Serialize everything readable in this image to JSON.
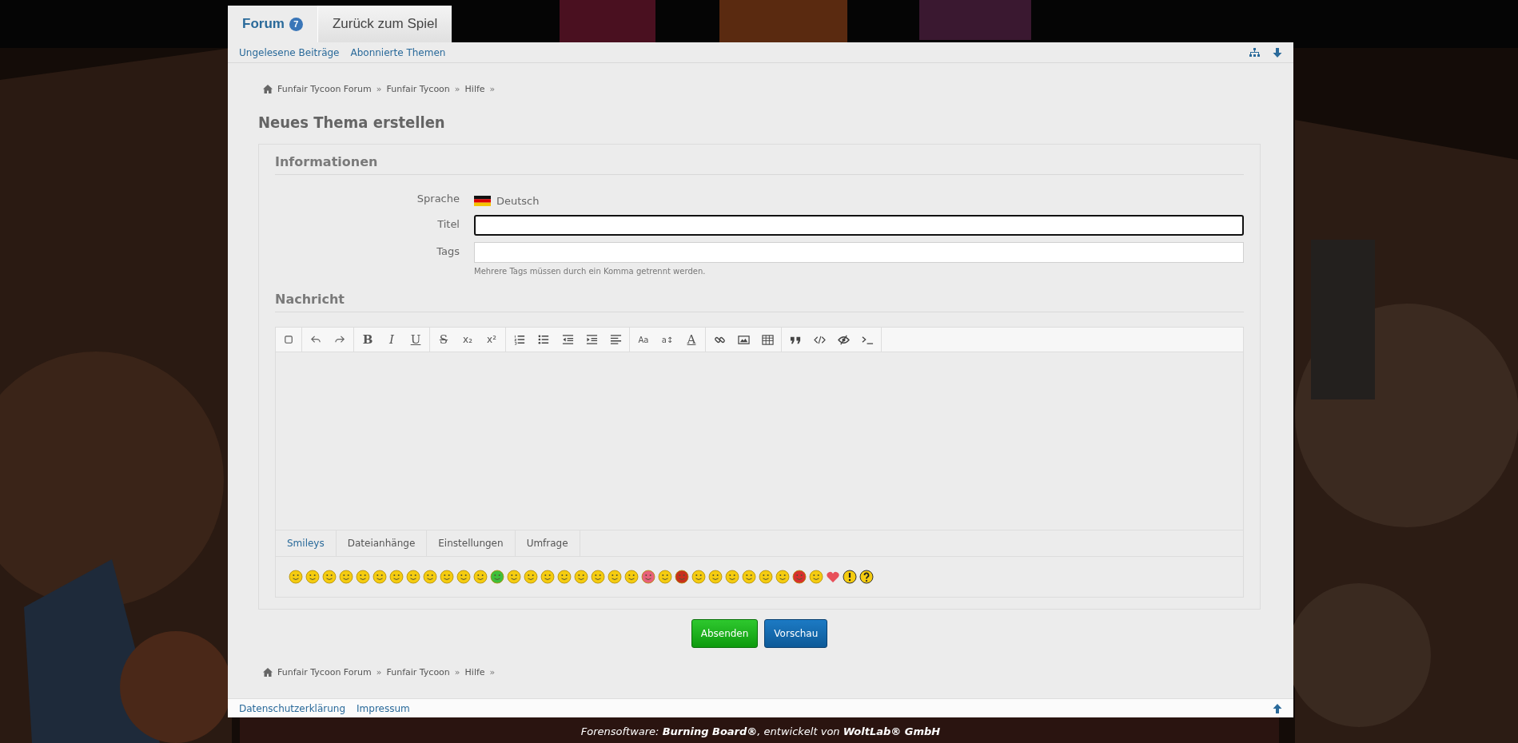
{
  "main_tabs": [
    {
      "label": "Forum",
      "badge": "7",
      "selected": true
    },
    {
      "label": "Zurück zum Spiel",
      "selected": false
    }
  ],
  "subnav": [
    "Ungelesene Beiträge",
    "Abonnierte Themen"
  ],
  "breadcrumb_top": [
    "Funfair Tycoon Forum",
    "»",
    "Funfair Tycoon",
    "»",
    "Hilfe",
    "»"
  ],
  "page_title": "Neues Thema erstellen",
  "sections": [
    {
      "heading": "Informationen"
    },
    {
      "heading": "Nachricht"
    }
  ],
  "fields": [
    {
      "kind": "language",
      "label": "Sprache",
      "value": "Deutsch"
    },
    {
      "kind": "input",
      "label": "Titel",
      "focused": true
    },
    {
      "kind": "input",
      "label": "Tags",
      "focused": false,
      "hint": "Mehrere Tags müssen durch ein Komma getrennt werden."
    }
  ],
  "toolbar": [
    [
      {
        "kind": "icon"
      }
    ],
    [
      {
        "kind": "icon"
      },
      {
        "kind": "icon"
      }
    ],
    [
      {
        "kind": "glyph",
        "text": "B"
      },
      {
        "kind": "glyph",
        "text": "I"
      },
      {
        "kind": "glyph",
        "text": "U"
      }
    ],
    [
      {
        "kind": "glyph",
        "text": "S"
      },
      {
        "kind": "glyph",
        "text": "x₂"
      },
      {
        "kind": "glyph",
        "text": "x²"
      }
    ],
    [
      {
        "kind": "icon"
      },
      {
        "kind": "icon"
      },
      {
        "kind": "icon"
      },
      {
        "kind": "icon"
      },
      {
        "kind": "icon"
      }
    ],
    [
      {
        "kind": "glyph",
        "text": "Aa"
      },
      {
        "kind": "glyph",
        "text": "a↕"
      },
      {
        "kind": "glyph",
        "text": "A"
      }
    ],
    [
      {
        "kind": "icon"
      },
      {
        "kind": "icon"
      },
      {
        "kind": "icon"
      }
    ],
    [
      {
        "kind": "icon"
      },
      {
        "kind": "icon"
      },
      {
        "kind": "icon"
      },
      {
        "kind": "icon"
      }
    ]
  ],
  "editor_tabs": [
    {
      "label": "Smileys",
      "selected": true
    },
    {
      "label": "Dateianhänge",
      "selected": false
    },
    {
      "label": "Einstellungen",
      "selected": false
    },
    {
      "label": "Umfrage",
      "selected": false
    }
  ],
  "smileys": [
    {
      "kind": "face",
      "color": "#f5cc10"
    },
    {
      "kind": "face",
      "color": "#f5cc10"
    },
    {
      "kind": "face",
      "color": "#f5cc10"
    },
    {
      "kind": "face",
      "color": "#f5cc10"
    },
    {
      "kind": "face",
      "color": "#f5cc10"
    },
    {
      "kind": "face",
      "color": "#f5cc10"
    },
    {
      "kind": "face",
      "color": "#f5cc10"
    },
    {
      "kind": "face",
      "color": "#f5cc10"
    },
    {
      "kind": "face",
      "color": "#f5cc10"
    },
    {
      "kind": "face",
      "color": "#f5cc10"
    },
    {
      "kind": "face",
      "color": "#f5cc10"
    },
    {
      "kind": "face",
      "color": "#f5cc10"
    },
    {
      "kind": "face",
      "color": "#3fbf3a"
    },
    {
      "kind": "face",
      "color": "#f5cc10"
    },
    {
      "kind": "face",
      "color": "#f5cc10"
    },
    {
      "kind": "face",
      "color": "#f5cc10"
    },
    {
      "kind": "face",
      "color": "#f5cc10"
    },
    {
      "kind": "face",
      "color": "#f5cc10"
    },
    {
      "kind": "face",
      "color": "#f5cc10"
    },
    {
      "kind": "face",
      "color": "#f5cc10"
    },
    {
      "kind": "face",
      "color": "#f5cc10"
    },
    {
      "kind": "face",
      "color": "#e8607a"
    },
    {
      "kind": "face",
      "color": "#f5cc10"
    },
    {
      "kind": "face",
      "color": "#c8301c"
    },
    {
      "kind": "face",
      "color": "#f5cc10"
    },
    {
      "kind": "face",
      "color": "#f5cc10"
    },
    {
      "kind": "face",
      "color": "#f5cc10"
    },
    {
      "kind": "face",
      "color": "#f5cc10"
    },
    {
      "kind": "face",
      "color": "#f5cc10"
    },
    {
      "kind": "face",
      "color": "#f5cc10"
    },
    {
      "kind": "face",
      "color": "#d8302c"
    },
    {
      "kind": "face",
      "color": "#f5cc10"
    },
    {
      "kind": "heart",
      "color": "#e8505a"
    },
    {
      "kind": "exclaim",
      "color": "#f5cc10"
    },
    {
      "kind": "question",
      "color": "#f5cc10"
    }
  ],
  "buttons": [
    {
      "label": "Absenden",
      "kind": "primary"
    },
    {
      "label": "Vorschau",
      "kind": "secondary"
    }
  ],
  "breadcrumb_bottom": [
    "Funfair Tycoon Forum",
    "»",
    "Funfair Tycoon",
    "»",
    "Hilfe",
    "»"
  ],
  "footer_links": [
    "Datenschutzerklärung",
    "Impressum"
  ],
  "copyright": "Forensoftware: **Burning Board®**, entwickelt von **WoltLab® GmbH**"
}
